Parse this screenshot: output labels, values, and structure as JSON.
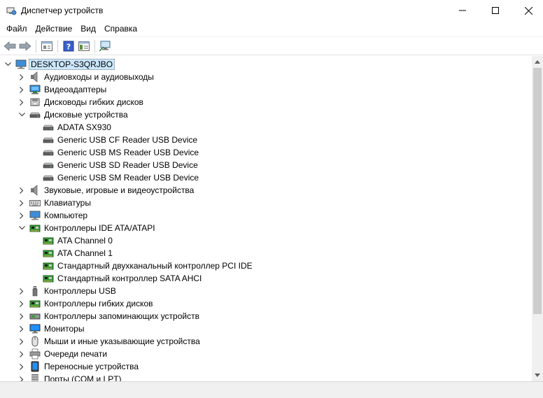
{
  "window": {
    "title": "Диспетчер устройств"
  },
  "menu": [
    "Файл",
    "Действие",
    "Вид",
    "Справка"
  ],
  "toolbar": {
    "buttons": [
      "back-icon",
      "forward-icon",
      "properties-icon",
      "help-icon",
      "console-tree-icon",
      "scan-hardware-icon"
    ]
  },
  "tree": {
    "root": "DESKTOP-S3QRJBO",
    "items": [
      {
        "label": "Аудиовходы и аудиовыходы",
        "level": 1,
        "expanded": false,
        "icon": "speaker-icon"
      },
      {
        "label": "Видеоадаптеры",
        "level": 1,
        "expanded": false,
        "icon": "display-adapter-icon"
      },
      {
        "label": "Дисководы гибких дисков",
        "level": 1,
        "expanded": false,
        "icon": "floppy-drive-icon"
      },
      {
        "label": "Дисковые устройства",
        "level": 1,
        "expanded": true,
        "icon": "disk-drive-icon"
      },
      {
        "label": "ADATA SX930",
        "level": 2,
        "icon": "disk-drive-icon"
      },
      {
        "label": "Generic USB CF Reader USB Device",
        "level": 2,
        "icon": "disk-drive-icon"
      },
      {
        "label": "Generic USB MS Reader USB Device",
        "level": 2,
        "icon": "disk-drive-icon"
      },
      {
        "label": "Generic USB SD Reader USB Device",
        "level": 2,
        "icon": "disk-drive-icon"
      },
      {
        "label": "Generic USB SM Reader USB Device",
        "level": 2,
        "icon": "disk-drive-icon"
      },
      {
        "label": "Звуковые, игровые и видеоустройства",
        "level": 1,
        "expanded": false,
        "icon": "speaker-icon"
      },
      {
        "label": "Клавиатуры",
        "level": 1,
        "expanded": false,
        "icon": "keyboard-icon"
      },
      {
        "label": "Компьютер",
        "level": 1,
        "expanded": false,
        "icon": "computer-icon"
      },
      {
        "label": "Контроллеры IDE ATA/ATAPI",
        "level": 1,
        "expanded": true,
        "icon": "ide-controller-icon"
      },
      {
        "label": "ATA Channel 0",
        "level": 2,
        "icon": "ide-controller-icon"
      },
      {
        "label": "ATA Channel 1",
        "level": 2,
        "icon": "ide-controller-icon"
      },
      {
        "label": "Стандартный двухканальный контроллер PCI IDE",
        "level": 2,
        "icon": "ide-controller-icon"
      },
      {
        "label": "Стандартный контроллер SATA AHCI",
        "level": 2,
        "icon": "ide-controller-icon"
      },
      {
        "label": "Контроллеры USB",
        "level": 1,
        "expanded": false,
        "icon": "usb-icon"
      },
      {
        "label": "Контроллеры гибких дисков",
        "level": 1,
        "expanded": false,
        "icon": "ide-controller-icon"
      },
      {
        "label": "Контроллеры запоминающих устройств",
        "level": 1,
        "expanded": false,
        "icon": "storage-controller-icon"
      },
      {
        "label": "Мониторы",
        "level": 1,
        "expanded": false,
        "icon": "monitor-icon"
      },
      {
        "label": "Мыши и иные указывающие устройства",
        "level": 1,
        "expanded": false,
        "icon": "mouse-icon"
      },
      {
        "label": "Очереди печати",
        "level": 1,
        "expanded": false,
        "icon": "printer-icon"
      },
      {
        "label": "Переносные устройства",
        "level": 1,
        "expanded": false,
        "icon": "portable-device-icon"
      },
      {
        "label": "Порты (COM и LPT)",
        "level": 1,
        "expanded": false,
        "icon": "port-icon"
      }
    ]
  },
  "colors": {
    "root_selection": "#cce8ff",
    "monitor_blue": "#1e90ff",
    "controller_green": "#2e8b2e"
  }
}
